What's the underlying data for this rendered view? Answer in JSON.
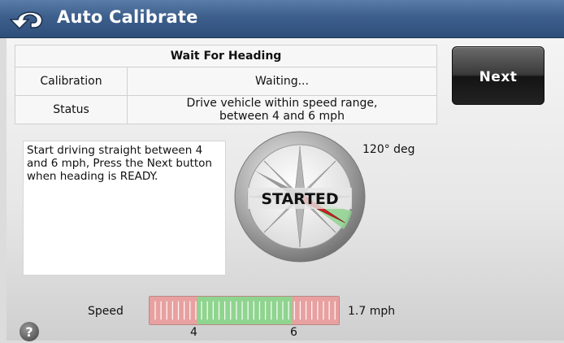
{
  "header": {
    "title": "Auto Calibrate",
    "back_icon": "back-arrow-icon"
  },
  "table": {
    "heading": "Wait For Heading",
    "rows": [
      {
        "label": "Calibration",
        "value": "Waiting..."
      },
      {
        "label": "Status",
        "value_line1": "Drive vehicle within speed range,",
        "value_line2": "between 4 and 6 mph"
      }
    ]
  },
  "next_button": {
    "label": "Next"
  },
  "instructions": {
    "line1": "Start driving straight between 4",
    "line2": "and 6 mph, Press the Next button",
    "line3": "when heading is READY."
  },
  "compass": {
    "status": "STARTED",
    "heading": "120° deg",
    "heading_degrees": 120
  },
  "speed": {
    "label": "Speed",
    "value": "1.7 mph",
    "current_mph": 1.7,
    "range_low": 4,
    "range_high": 6,
    "tick_low_label": "4",
    "tick_high_label": "6"
  },
  "help": {
    "label": "?"
  },
  "colors": {
    "title_bar": "#3d5f8c",
    "in_range": "#8fd48f",
    "out_of_range": "#e8a0a0",
    "needle": "#cc2222"
  }
}
